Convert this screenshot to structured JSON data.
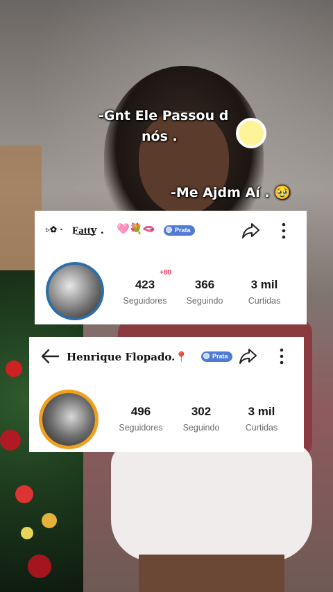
{
  "captions": {
    "line1": "-Gnt Ele Passou d",
    "line2": "nós .",
    "line3": "-Me Ajdm Aí . 🥹"
  },
  "profile_card_1": {
    "name_prefix": "▹✿ ·",
    "username": "F͟a͟t͟t͟y .",
    "emoji_tail": "🩷💐🫦",
    "badge": "Prata",
    "stats": [
      {
        "value": "423",
        "label": "Seguidores"
      },
      {
        "value": "366",
        "label": "Seguindo"
      },
      {
        "value": "3 mil",
        "label": "Curtidas"
      }
    ],
    "followers_delta": "+80"
  },
  "profile_card_2": {
    "username": "Henrique Flopado.📍",
    "badge": "Prata",
    "stats": [
      {
        "value": "496",
        "label": "Seguidores"
      },
      {
        "value": "302",
        "label": "Seguindo"
      },
      {
        "value": "3 mil",
        "label": "Curtidas"
      }
    ]
  },
  "icons": {
    "share": "share-arrow-icon",
    "more": "more-vertical-icon",
    "back": "back-arrow-icon"
  },
  "colors": {
    "badge": "#4f7ad6",
    "delta": "#ff3b5c",
    "caption_text": "#ffffff"
  }
}
